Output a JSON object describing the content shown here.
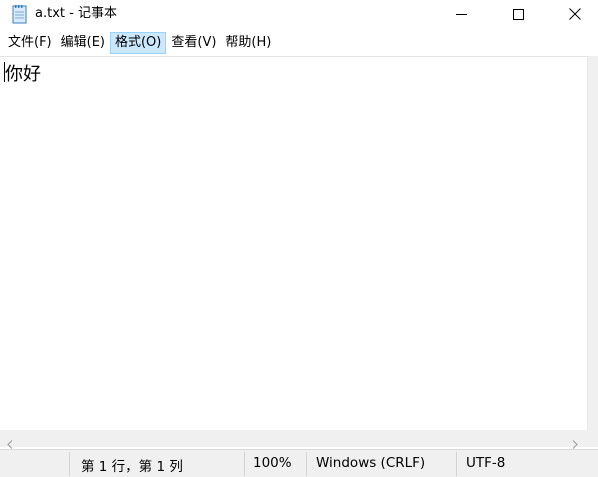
{
  "window": {
    "title": "a.txt - 记事本",
    "icon": "notepad-icon"
  },
  "window_controls": {
    "minimize_icon": "minimize-icon",
    "maximize_icon": "maximize-icon",
    "close_icon": "close-icon"
  },
  "menu": {
    "items": [
      {
        "label": "文件(F)",
        "active": false
      },
      {
        "label": "编辑(E)",
        "active": false
      },
      {
        "label": "格式(O)",
        "active": true
      },
      {
        "label": "查看(V)",
        "active": false
      },
      {
        "label": "帮助(H)",
        "active": false
      }
    ]
  },
  "editor": {
    "content": "你好"
  },
  "status": {
    "position": "第 1 行，第 1 列",
    "zoom": "100%",
    "line_ending": "Windows (CRLF)",
    "encoding": "UTF-8"
  },
  "colors": {
    "menu_active_bg": "#cce8ff",
    "menu_active_border": "#99d1ff",
    "statusbar_bg": "#f0f0f0"
  }
}
